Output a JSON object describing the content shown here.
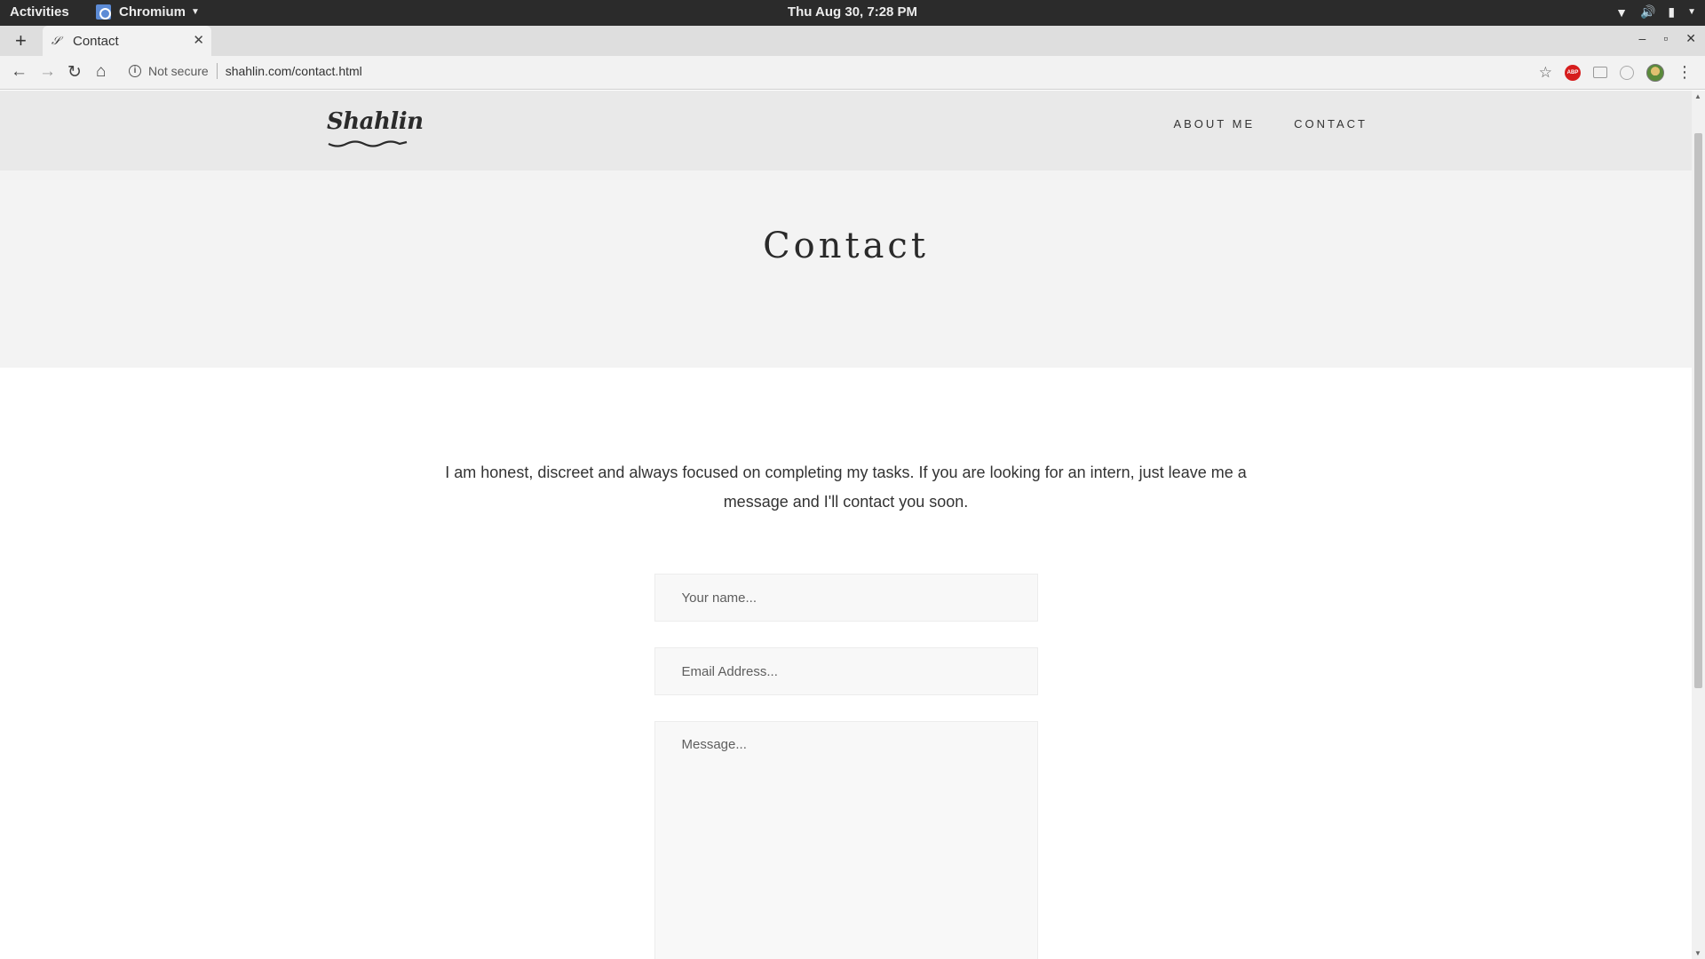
{
  "system_bar": {
    "activities": "Activities",
    "app_name": "Chromium",
    "clock": "Thu Aug 30,  7:28 PM"
  },
  "browser": {
    "tab_title": "Contact",
    "security_label": "Not secure",
    "url": "shahlin.com/contact.html",
    "extensions": [
      "star-icon",
      "adblock-plus-icon",
      "cast-icon",
      "extension-icon",
      "profile-avatar",
      "menu-icon"
    ]
  },
  "site": {
    "logo": "Shahlin",
    "nav": [
      {
        "label": "ABOUT ME"
      },
      {
        "label": "CONTACT"
      }
    ]
  },
  "page": {
    "title": "Contact",
    "intro": "I am honest, discreet and always focused on completing my tasks. If you are looking for an intern, just leave me a message and I'll contact you soon.",
    "form": {
      "name_placeholder": "Your name...",
      "email_placeholder": "Email Address...",
      "message_placeholder": "Message..."
    }
  }
}
